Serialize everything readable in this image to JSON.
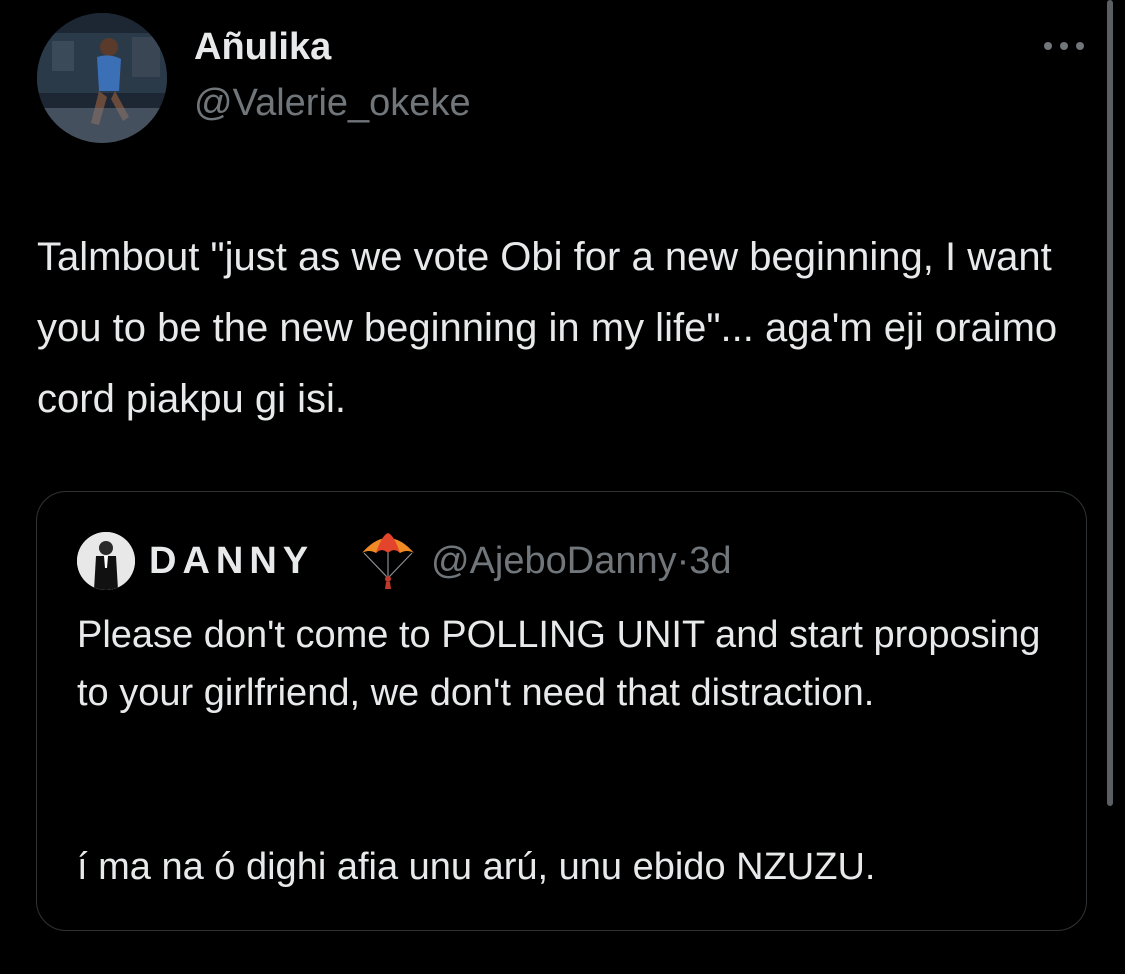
{
  "tweet": {
    "author": {
      "display_name": "Añulika",
      "handle": "@Valerie_okeke"
    },
    "more_icon": "more-horizontal-icon",
    "text": "Talmbout \"just as we vote Obi for a new beginning, I want you to be the new beginning in my life\"... aga'm eji oraimo cord piakpu gi isi."
  },
  "quoted_tweet": {
    "author": {
      "display_name": "DANNY",
      "emoji": "parachute-icon",
      "handle": "@AjeboDanny",
      "separator": "·",
      "time": "3d"
    },
    "text_paragraph_1": "Please don't come to POLLING UNIT and start proposing to your girlfriend, we don't need that distraction.",
    "text_paragraph_2": "í ma na ó dighi afia unu arú, unu ebido NZUZU."
  },
  "colors": {
    "background": "#000000",
    "text_primary": "#e7e9ea",
    "text_secondary": "#71767b",
    "border": "#2f3336"
  }
}
